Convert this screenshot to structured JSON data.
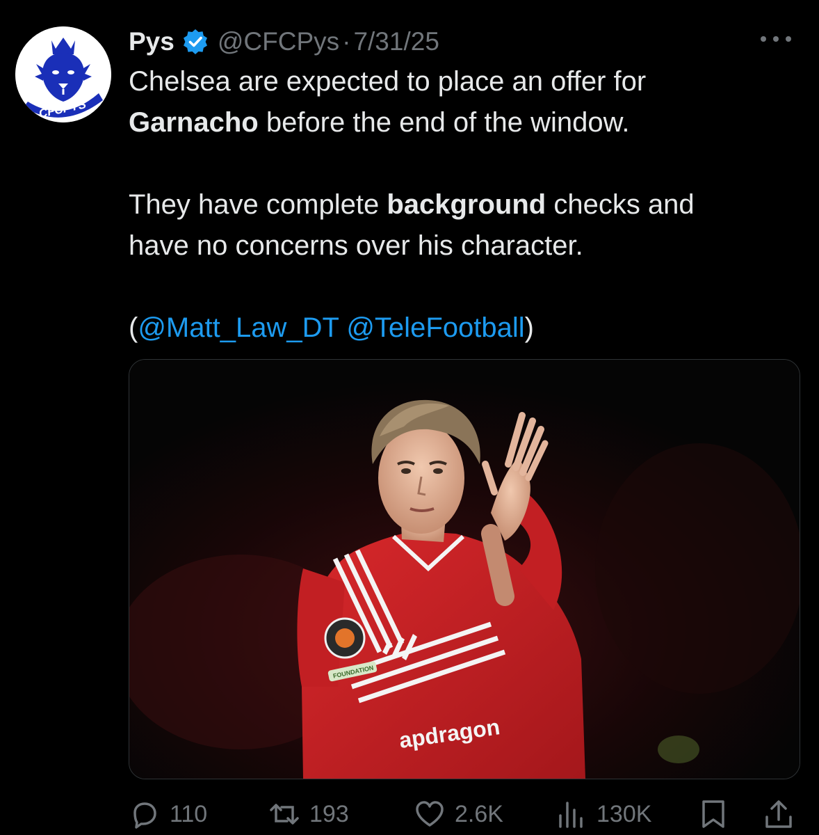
{
  "author": {
    "display_name": "Pys",
    "handle": "@CFCPys",
    "separator": "·",
    "date": "7/31/25",
    "avatar_text": "CFCPYS",
    "verified_icon": "verified-badge-icon",
    "brand_color": "#1a2fb8"
  },
  "tweet": {
    "line1": "Chelsea are expected to place an offer for",
    "line2_bold": "Garnacho",
    "line2_rest": " before the end of the window.",
    "line3_pre": "They have complete ",
    "line3_bold": "background",
    "line3_post": " checks and",
    "line4": "have no concerns over his character.",
    "source_open": "(",
    "mention1": "@Matt_Law_DT",
    "mention2": "@TeleFootball",
    "source_close": ")",
    "mention_color": "#1d9bf0"
  },
  "media": {
    "shirt_sponsor": "apdragon",
    "sleeve_patch": "FOUNDATION"
  },
  "actions": {
    "replies": "110",
    "retweets": "193",
    "likes": "2.6K",
    "views": "130K",
    "icons": [
      "reply-icon",
      "retweet-icon",
      "like-icon",
      "views-icon",
      "bookmark-icon",
      "share-icon"
    ]
  }
}
